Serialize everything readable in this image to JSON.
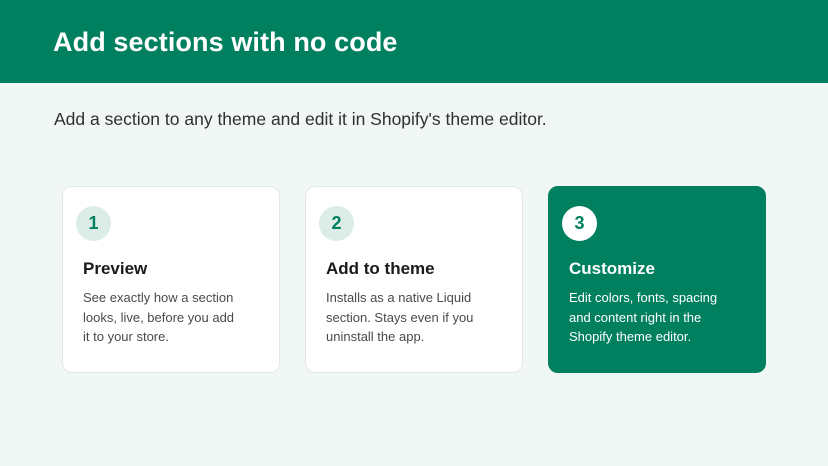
{
  "header": {
    "title": "Add sections with no code"
  },
  "subtitle": "Add a section to any theme and edit it in Shopify's theme editor.",
  "steps": [
    {
      "number": "1",
      "title": "Preview",
      "description": "See exactly how a section looks, live, before you add it to your store."
    },
    {
      "number": "2",
      "title": "Add to theme",
      "description": "Installs as a native Liquid section. Stays even if you uninstall the app."
    },
    {
      "number": "3",
      "title": "Customize",
      "description": "Edit colors, fonts, spacing and content right in the Shopify theme editor."
    }
  ],
  "colors": {
    "brand": "#018060",
    "background": "#f1f7f4",
    "badge": "#dcece6"
  }
}
